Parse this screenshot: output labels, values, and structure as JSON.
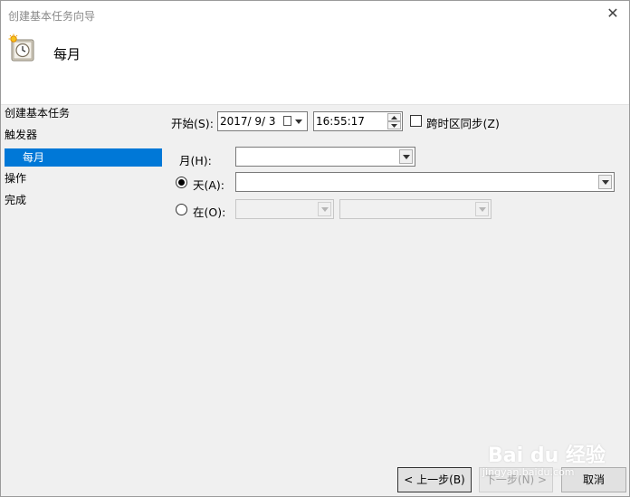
{
  "window": {
    "title": "创建基本任务向导",
    "close_glyph": "✕"
  },
  "header": {
    "title": "每月",
    "icon": "task-clock-icon"
  },
  "sidebar": {
    "items": [
      {
        "label": "创建基本任务"
      },
      {
        "label": "触发器"
      },
      {
        "label": "每月",
        "selected": true
      },
      {
        "label": "操作"
      },
      {
        "label": "完成"
      }
    ]
  },
  "form": {
    "start_label": "开始(S):",
    "start_date": "2017/  9/  3",
    "start_time": "16:55:17",
    "sync_tz_label": "跨时区同步(Z)",
    "sync_tz_checked": false,
    "month_label": "月(H):",
    "month_value": "",
    "day_label": "天(A):",
    "day_value": "",
    "day_selected": true,
    "on_label": "在(O):",
    "on_selected": false,
    "on_week_value": "",
    "on_weekday_value": ""
  },
  "buttons": {
    "back": "< 上一步(B)",
    "next": "下一步(N) >",
    "cancel": "取消"
  },
  "watermark": {
    "line1": "Bai du 经验",
    "line2": "jingyan.baidu.com"
  },
  "colors": {
    "selection": "#0078d7",
    "background": "#f0f0f0"
  }
}
